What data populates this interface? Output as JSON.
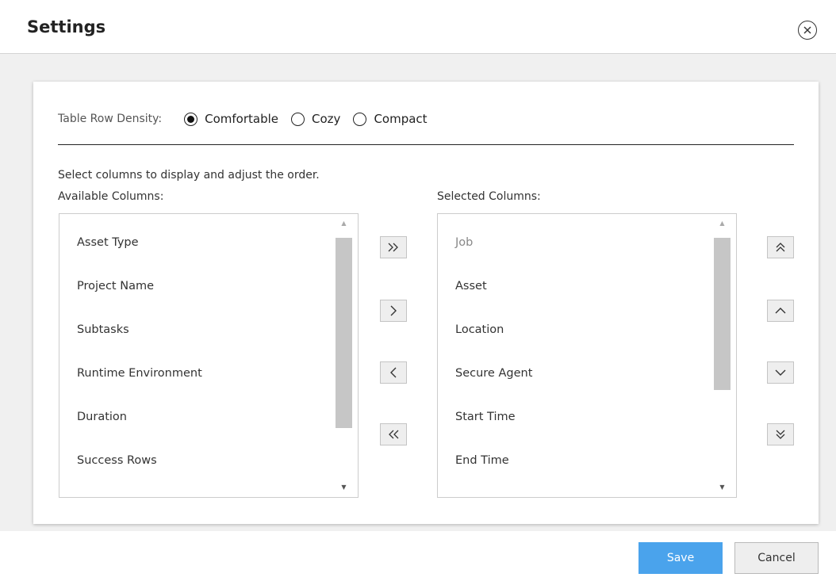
{
  "dialog": {
    "title": "Settings"
  },
  "density": {
    "label": "Table Row Density:",
    "options": [
      "Comfortable",
      "Cozy",
      "Compact"
    ],
    "selected": "Comfortable"
  },
  "columns": {
    "instructions": "Select columns to display and adjust the order.",
    "available_label": "Available Columns:",
    "selected_label": "Selected Columns:",
    "available": [
      "Asset Type",
      "Project Name",
      "Subtasks",
      "Runtime Environment",
      "Duration",
      "Success Rows"
    ],
    "selected": [
      "Job",
      "Asset",
      "Location",
      "Secure Agent",
      "Start Time",
      "End Time"
    ]
  },
  "footer": {
    "save_label": "Save",
    "cancel_label": "Cancel"
  },
  "colors": {
    "accent": "#4aa3ec",
    "body_background": "#f0f0f0"
  }
}
